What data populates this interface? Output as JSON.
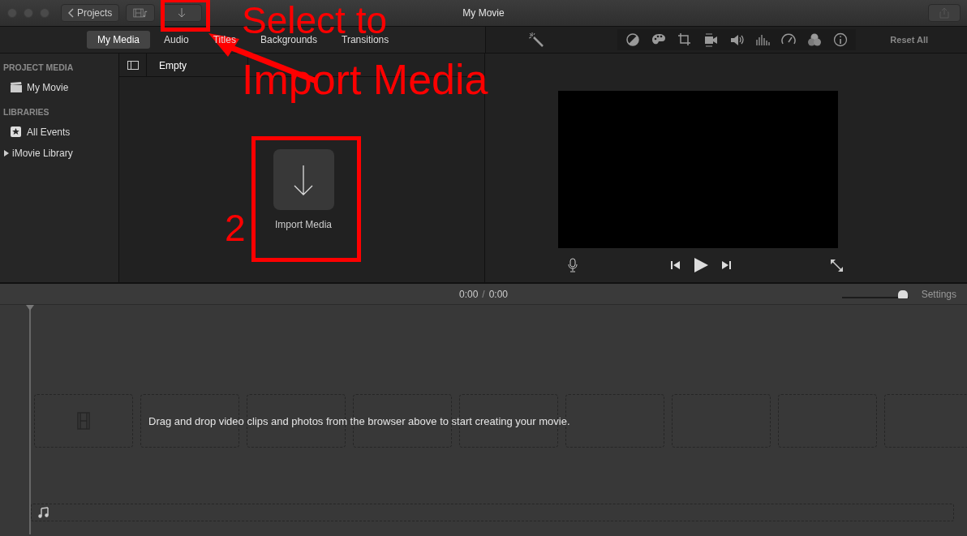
{
  "window": {
    "title": "My Movie"
  },
  "toolbar": {
    "back_button": "Projects"
  },
  "media_tabs": [
    {
      "label": "My Media",
      "selected": true
    },
    {
      "label": "Audio",
      "selected": false
    },
    {
      "label": "Titles",
      "selected": false
    },
    {
      "label": "Backgrounds",
      "selected": false
    },
    {
      "label": "Transitions",
      "selected": false
    }
  ],
  "sidebar": {
    "sections": [
      {
        "heading": "PROJECT MEDIA",
        "items": [
          {
            "label": "My Movie",
            "kind": "project"
          }
        ]
      },
      {
        "heading": "LIBRARIES",
        "items": [
          {
            "label": "All Events",
            "kind": "events"
          },
          {
            "label": "iMovie Library",
            "kind": "library",
            "expanded": false
          }
        ]
      }
    ]
  },
  "browser": {
    "filter": "Empty",
    "import_label": "Import Media"
  },
  "viewer": {
    "reset_button": "Reset All"
  },
  "timeline": {
    "current_time": "0:00",
    "separator": "/",
    "duration": "0:00",
    "zoom": {
      "level": 0.92
    },
    "settings_button": "Settings",
    "hint": "Drag and drop video clips and photos from the browser above to start creating your movie."
  },
  "annotations": [
    {
      "kind": "callout",
      "lines": [
        "Select to",
        "Import Media"
      ]
    },
    {
      "kind": "step",
      "text": "2"
    }
  ]
}
